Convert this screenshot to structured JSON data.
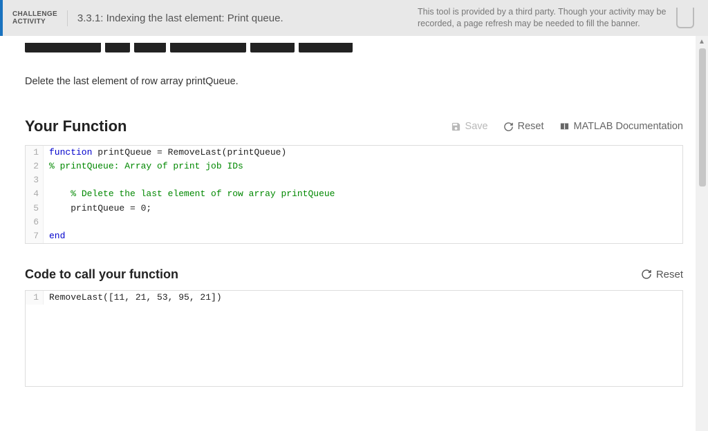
{
  "header": {
    "badge_line1": "CHALLENGE",
    "badge_line2": "ACTIVITY",
    "title": "3.3.1: Indexing the last element: Print queue.",
    "note": "This tool is provided by a third party. Though your activity may be recorded, a page refresh may be needed to fill the banner."
  },
  "instruction": "Delete the last element of row array printQueue.",
  "function_section": {
    "title": "Your Function",
    "save_label": "Save",
    "reset_label": "Reset",
    "doc_label": "MATLAB Documentation",
    "code": [
      {
        "n": "1",
        "segments": [
          {
            "cls": "kw-blue",
            "t": "function"
          },
          {
            "cls": "kw-black",
            "t": " printQueue = RemoveLast(printQueue)"
          }
        ]
      },
      {
        "n": "2",
        "segments": [
          {
            "cls": "kw-green",
            "t": "% printQueue: Array of print job IDs"
          }
        ]
      },
      {
        "n": "3",
        "segments": [
          {
            "cls": "kw-black",
            "t": ""
          }
        ]
      },
      {
        "n": "4",
        "segments": [
          {
            "cls": "kw-black",
            "t": "    "
          },
          {
            "cls": "kw-green",
            "t": "% Delete the last element of row array printQueue"
          }
        ]
      },
      {
        "n": "5",
        "segments": [
          {
            "cls": "kw-black",
            "t": "    printQueue = 0;"
          }
        ]
      },
      {
        "n": "6",
        "segments": [
          {
            "cls": "kw-black",
            "t": ""
          }
        ]
      },
      {
        "n": "7",
        "segments": [
          {
            "cls": "kw-blue",
            "t": "end"
          }
        ]
      }
    ]
  },
  "call_section": {
    "title": "Code to call your function",
    "reset_label": "Reset",
    "code": [
      {
        "n": "1",
        "segments": [
          {
            "cls": "kw-black",
            "t": "RemoveLast([11, 21, 53, 95, 21])"
          }
        ]
      }
    ]
  }
}
